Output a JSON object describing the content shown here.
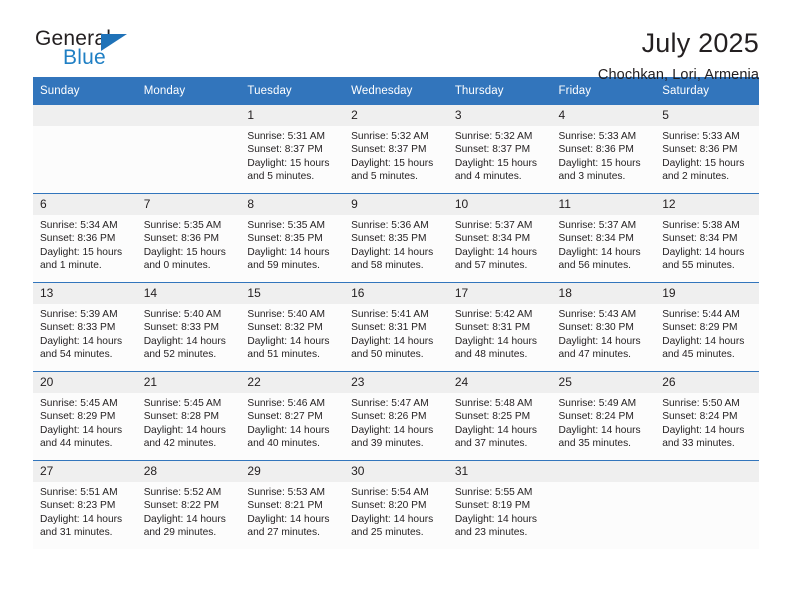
{
  "brand": {
    "name_top": "General",
    "name_bottom": "Blue",
    "accent_color": "#1f72b8"
  },
  "header": {
    "title": "July 2025",
    "subtitle": "Chochkan, Lori, Armenia"
  },
  "theme": {
    "header_blue": "#3275bc",
    "daynum_band": "#efefef",
    "cell_background": "#fcfcfc",
    "text": "#231f20"
  },
  "calendar": {
    "weekday_headers": [
      "Sunday",
      "Monday",
      "Tuesday",
      "Wednesday",
      "Thursday",
      "Friday",
      "Saturday"
    ],
    "weeks": [
      [
        {
          "day": "",
          "sunrise": "",
          "sunset": "",
          "daylight": "",
          "empty": true
        },
        {
          "day": "",
          "sunrise": "",
          "sunset": "",
          "daylight": "",
          "empty": true
        },
        {
          "day": "1",
          "sunrise": "Sunrise: 5:31 AM",
          "sunset": "Sunset: 8:37 PM",
          "daylight": "Daylight: 15 hours and 5 minutes."
        },
        {
          "day": "2",
          "sunrise": "Sunrise: 5:32 AM",
          "sunset": "Sunset: 8:37 PM",
          "daylight": "Daylight: 15 hours and 5 minutes."
        },
        {
          "day": "3",
          "sunrise": "Sunrise: 5:32 AM",
          "sunset": "Sunset: 8:37 PM",
          "daylight": "Daylight: 15 hours and 4 minutes."
        },
        {
          "day": "4",
          "sunrise": "Sunrise: 5:33 AM",
          "sunset": "Sunset: 8:36 PM",
          "daylight": "Daylight: 15 hours and 3 minutes."
        },
        {
          "day": "5",
          "sunrise": "Sunrise: 5:33 AM",
          "sunset": "Sunset: 8:36 PM",
          "daylight": "Daylight: 15 hours and 2 minutes."
        }
      ],
      [
        {
          "day": "6",
          "sunrise": "Sunrise: 5:34 AM",
          "sunset": "Sunset: 8:36 PM",
          "daylight": "Daylight: 15 hours and 1 minute."
        },
        {
          "day": "7",
          "sunrise": "Sunrise: 5:35 AM",
          "sunset": "Sunset: 8:36 PM",
          "daylight": "Daylight: 15 hours and 0 minutes."
        },
        {
          "day": "8",
          "sunrise": "Sunrise: 5:35 AM",
          "sunset": "Sunset: 8:35 PM",
          "daylight": "Daylight: 14 hours and 59 minutes."
        },
        {
          "day": "9",
          "sunrise": "Sunrise: 5:36 AM",
          "sunset": "Sunset: 8:35 PM",
          "daylight": "Daylight: 14 hours and 58 minutes."
        },
        {
          "day": "10",
          "sunrise": "Sunrise: 5:37 AM",
          "sunset": "Sunset: 8:34 PM",
          "daylight": "Daylight: 14 hours and 57 minutes."
        },
        {
          "day": "11",
          "sunrise": "Sunrise: 5:37 AM",
          "sunset": "Sunset: 8:34 PM",
          "daylight": "Daylight: 14 hours and 56 minutes."
        },
        {
          "day": "12",
          "sunrise": "Sunrise: 5:38 AM",
          "sunset": "Sunset: 8:34 PM",
          "daylight": "Daylight: 14 hours and 55 minutes."
        }
      ],
      [
        {
          "day": "13",
          "sunrise": "Sunrise: 5:39 AM",
          "sunset": "Sunset: 8:33 PM",
          "daylight": "Daylight: 14 hours and 54 minutes."
        },
        {
          "day": "14",
          "sunrise": "Sunrise: 5:40 AM",
          "sunset": "Sunset: 8:33 PM",
          "daylight": "Daylight: 14 hours and 52 minutes."
        },
        {
          "day": "15",
          "sunrise": "Sunrise: 5:40 AM",
          "sunset": "Sunset: 8:32 PM",
          "daylight": "Daylight: 14 hours and 51 minutes."
        },
        {
          "day": "16",
          "sunrise": "Sunrise: 5:41 AM",
          "sunset": "Sunset: 8:31 PM",
          "daylight": "Daylight: 14 hours and 50 minutes."
        },
        {
          "day": "17",
          "sunrise": "Sunrise: 5:42 AM",
          "sunset": "Sunset: 8:31 PM",
          "daylight": "Daylight: 14 hours and 48 minutes."
        },
        {
          "day": "18",
          "sunrise": "Sunrise: 5:43 AM",
          "sunset": "Sunset: 8:30 PM",
          "daylight": "Daylight: 14 hours and 47 minutes."
        },
        {
          "day": "19",
          "sunrise": "Sunrise: 5:44 AM",
          "sunset": "Sunset: 8:29 PM",
          "daylight": "Daylight: 14 hours and 45 minutes."
        }
      ],
      [
        {
          "day": "20",
          "sunrise": "Sunrise: 5:45 AM",
          "sunset": "Sunset: 8:29 PM",
          "daylight": "Daylight: 14 hours and 44 minutes."
        },
        {
          "day": "21",
          "sunrise": "Sunrise: 5:45 AM",
          "sunset": "Sunset: 8:28 PM",
          "daylight": "Daylight: 14 hours and 42 minutes."
        },
        {
          "day": "22",
          "sunrise": "Sunrise: 5:46 AM",
          "sunset": "Sunset: 8:27 PM",
          "daylight": "Daylight: 14 hours and 40 minutes."
        },
        {
          "day": "23",
          "sunrise": "Sunrise: 5:47 AM",
          "sunset": "Sunset: 8:26 PM",
          "daylight": "Daylight: 14 hours and 39 minutes."
        },
        {
          "day": "24",
          "sunrise": "Sunrise: 5:48 AM",
          "sunset": "Sunset: 8:25 PM",
          "daylight": "Daylight: 14 hours and 37 minutes."
        },
        {
          "day": "25",
          "sunrise": "Sunrise: 5:49 AM",
          "sunset": "Sunset: 8:24 PM",
          "daylight": "Daylight: 14 hours and 35 minutes."
        },
        {
          "day": "26",
          "sunrise": "Sunrise: 5:50 AM",
          "sunset": "Sunset: 8:24 PM",
          "daylight": "Daylight: 14 hours and 33 minutes."
        }
      ],
      [
        {
          "day": "27",
          "sunrise": "Sunrise: 5:51 AM",
          "sunset": "Sunset: 8:23 PM",
          "daylight": "Daylight: 14 hours and 31 minutes."
        },
        {
          "day": "28",
          "sunrise": "Sunrise: 5:52 AM",
          "sunset": "Sunset: 8:22 PM",
          "daylight": "Daylight: 14 hours and 29 minutes."
        },
        {
          "day": "29",
          "sunrise": "Sunrise: 5:53 AM",
          "sunset": "Sunset: 8:21 PM",
          "daylight": "Daylight: 14 hours and 27 minutes."
        },
        {
          "day": "30",
          "sunrise": "Sunrise: 5:54 AM",
          "sunset": "Sunset: 8:20 PM",
          "daylight": "Daylight: 14 hours and 25 minutes."
        },
        {
          "day": "31",
          "sunrise": "Sunrise: 5:55 AM",
          "sunset": "Sunset: 8:19 PM",
          "daylight": "Daylight: 14 hours and 23 minutes."
        },
        {
          "day": "",
          "sunrise": "",
          "sunset": "",
          "daylight": "",
          "empty": true
        },
        {
          "day": "",
          "sunrise": "",
          "sunset": "",
          "daylight": "",
          "empty": true
        }
      ]
    ]
  }
}
